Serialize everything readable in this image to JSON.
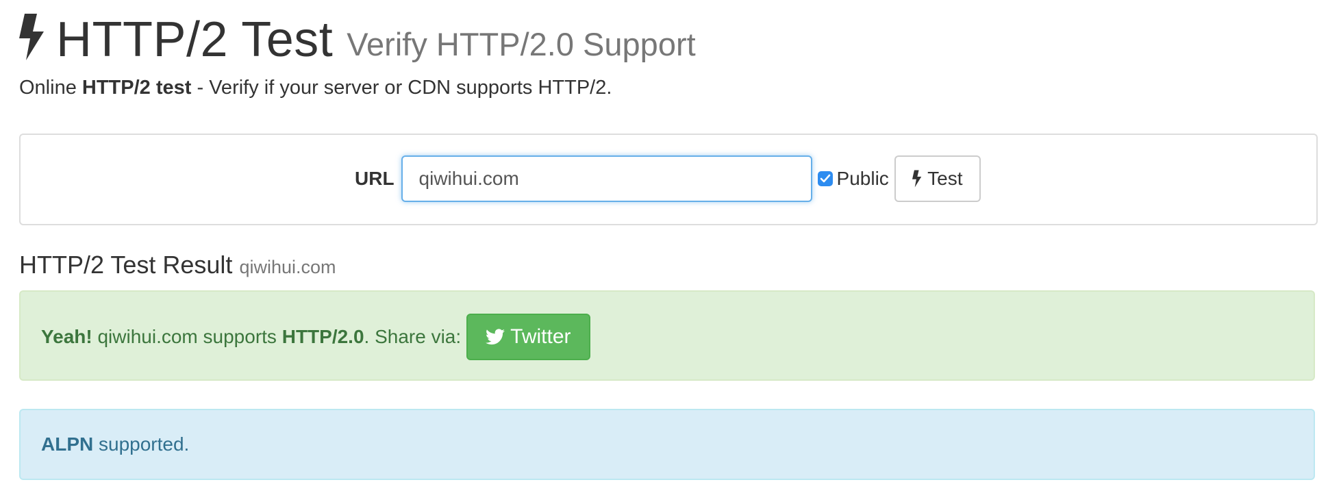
{
  "header": {
    "title": "HTTP/2 Test",
    "subtitle": "Verify HTTP/2.0 Support",
    "icon": "bolt-icon"
  },
  "lead": {
    "prefix": "Online ",
    "bold": "HTTP/2 test",
    "suffix": " - Verify if your server or CDN supports HTTP/2."
  },
  "form": {
    "url_label": "URL",
    "url_value": "qiwihui.com",
    "public_label": "Public",
    "public_checked": true,
    "test_button_label": "Test",
    "accent_color": "#66afe9"
  },
  "result": {
    "title": "HTTP/2 Test Result",
    "host": "qiwihui.com",
    "success": {
      "exclaim": "Yeah!",
      "text_before": " qiwihui.com supports ",
      "protocol": "HTTP/2.0",
      "text_after": ". Share via:",
      "share_button_label": "Twitter",
      "color": "#5cb85c"
    },
    "info": {
      "bold": "ALPN",
      "text": " supported."
    }
  }
}
